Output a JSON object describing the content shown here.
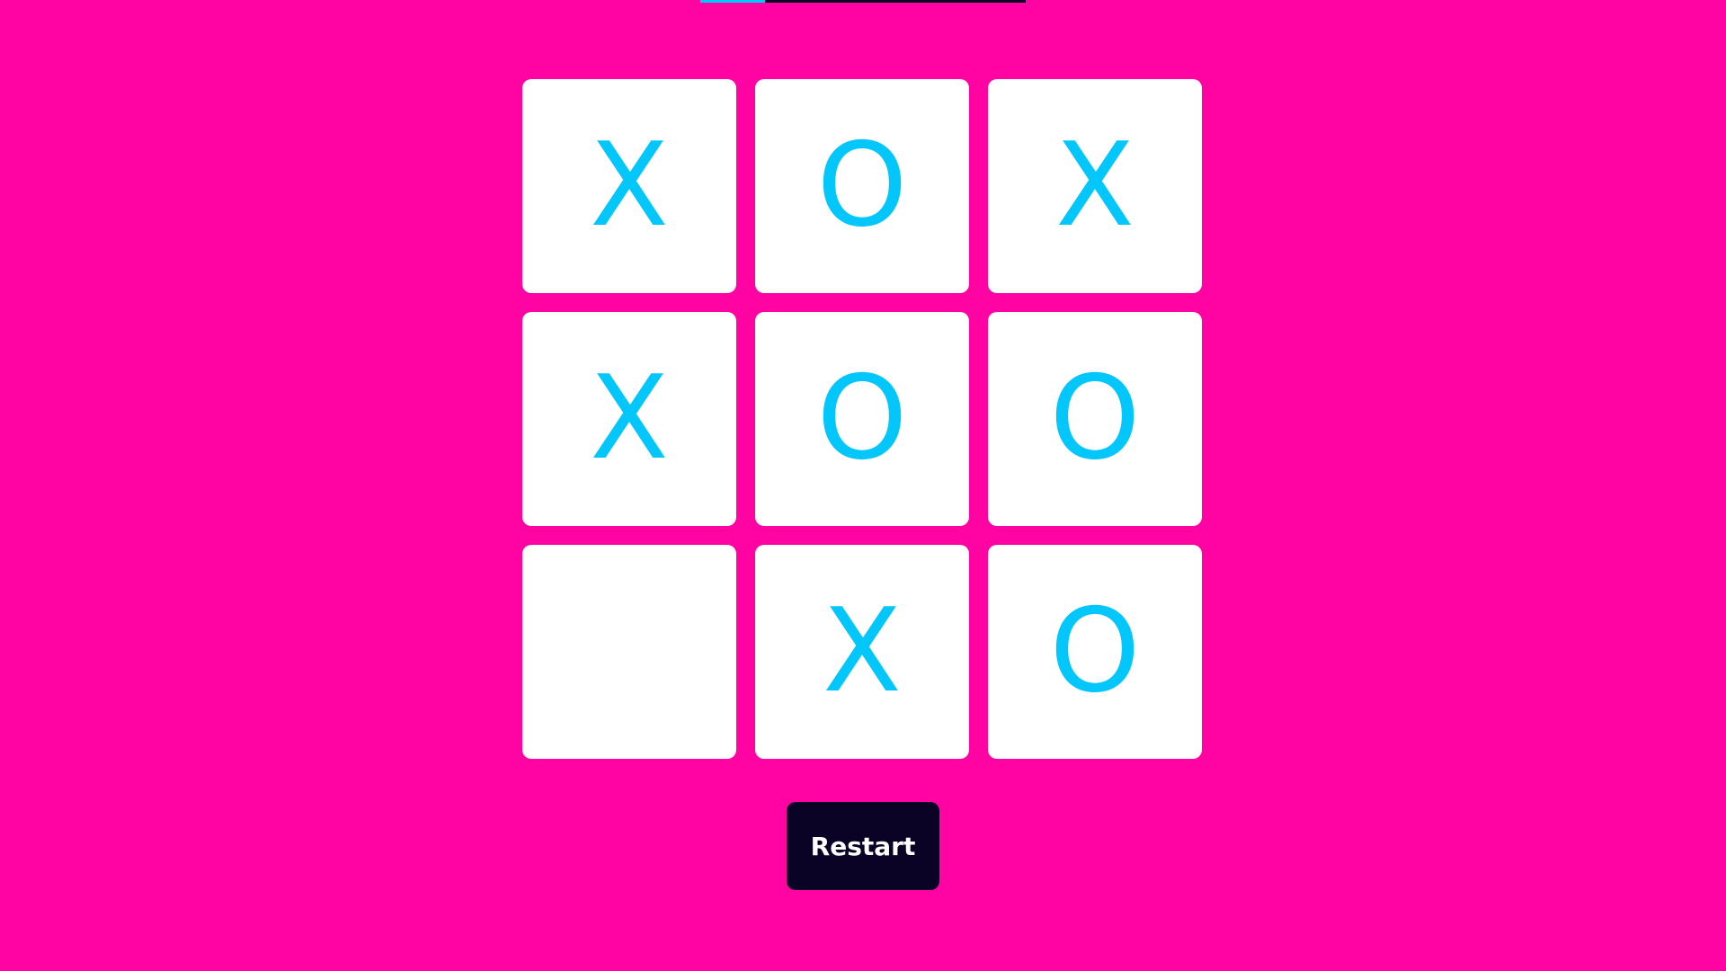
{
  "progress": {
    "value": 0.2,
    "fill_color": "#03c6fb",
    "track_color": "#0a0325"
  },
  "board": {
    "cells": [
      "X",
      "O",
      "X",
      "X",
      "O",
      "O",
      "",
      "X",
      "O"
    ]
  },
  "colors": {
    "background": "#ff03a3",
    "cell": "#ffffff",
    "mark": "#03c6fb",
    "button": "#0a0325",
    "button_text": "#ffffff"
  },
  "restart_label": "Restart"
}
